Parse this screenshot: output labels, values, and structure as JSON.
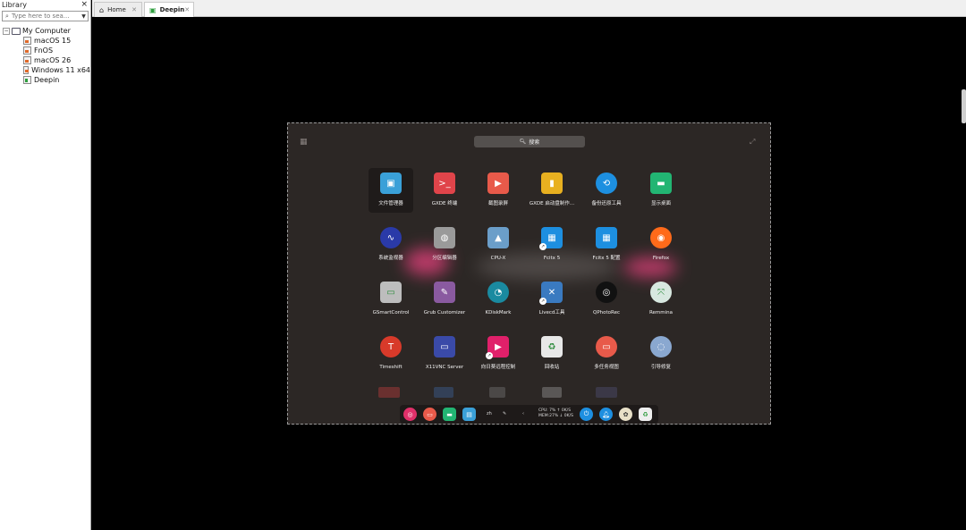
{
  "library": {
    "title": "Library",
    "close_label": "×",
    "search_placeholder": "Type here to sea...",
    "tree": {
      "root_label": "My Computer",
      "items": [
        "macOS 15",
        "FnOS",
        "macOS 26",
        "Windows 11 x64",
        "Deepin"
      ]
    }
  },
  "tabs": [
    {
      "label": "Home",
      "icon": "home-icon"
    },
    {
      "label": "Deepin",
      "icon": "vm-running-icon"
    }
  ],
  "launcher": {
    "search_label": "搜索",
    "apps": [
      {
        "label": "文件管理器",
        "icon": "file-manager-icon",
        "color": "#3aa0d8"
      },
      {
        "label": "GXDE 终端",
        "icon": "terminal-icon",
        "color": "#e0444a"
      },
      {
        "label": "截图录屏",
        "icon": "screen-recorder-icon",
        "color": "#e85a4a"
      },
      {
        "label": "GXDE 启动盘制作...",
        "icon": "boot-maker-icon",
        "color": "#e8b020"
      },
      {
        "label": "备份还原工具",
        "icon": "backup-restore-icon",
        "color": "#1d8fe0"
      },
      {
        "label": "显示桌面",
        "icon": "show-desktop-icon",
        "color": "#22b573"
      },
      {
        "label": "系统监视器",
        "icon": "system-monitor-icon",
        "color": "#2a3aa8"
      },
      {
        "label": "分区编辑器",
        "icon": "partition-editor-icon",
        "color": "#9a9a9a"
      },
      {
        "label": "CPU-X",
        "icon": "cpux-icon",
        "color": "#6b9ec9"
      },
      {
        "label": "Fcitx 5",
        "icon": "fcitx-icon",
        "color": "#1d8fe0"
      },
      {
        "label": "Fcitx 5 配置",
        "icon": "fcitx-config-icon",
        "color": "#1d8fe0"
      },
      {
        "label": "Firefox",
        "icon": "firefox-icon",
        "color": "#ff6a1a"
      },
      {
        "label": "GSmartControl",
        "icon": "gsmartcontrol-icon",
        "color": "#bdbdbd"
      },
      {
        "label": "Grub Customizer",
        "icon": "grub-customizer-icon",
        "color": "#8a5aa0"
      },
      {
        "label": "KDiskMark",
        "icon": "kdiskmark-icon",
        "color": "#1a8aa0"
      },
      {
        "label": "Livecd工具",
        "icon": "livecd-tool-icon",
        "color": "#3a7ac0"
      },
      {
        "label": "QPhotoRec",
        "icon": "qphotorec-icon",
        "color": "#111111"
      },
      {
        "label": "Remmina",
        "icon": "remmina-icon",
        "color": "#d8e8e0"
      },
      {
        "label": "Timeshift",
        "icon": "timeshift-icon",
        "color": "#d83a2a"
      },
      {
        "label": "X11VNC Server",
        "icon": "x11vnc-icon",
        "color": "#3a4aa8"
      },
      {
        "label": "向日葵远程控制",
        "icon": "sunlogin-icon",
        "color": "#e0206a"
      },
      {
        "label": "回收站",
        "icon": "trash-icon",
        "color": "#e8e8e8"
      },
      {
        "label": "多任务视图",
        "icon": "multitask-view-icon",
        "color": "#e85a4a"
      },
      {
        "label": "引导修复",
        "icon": "boot-repair-icon",
        "color": "#8aa8d0"
      }
    ]
  },
  "dock": {
    "lang": "zh",
    "stats_cpu": "CPU: 7% ↑  0K/S",
    "stats_mem": "MEM:27% ↓  0K/S"
  }
}
